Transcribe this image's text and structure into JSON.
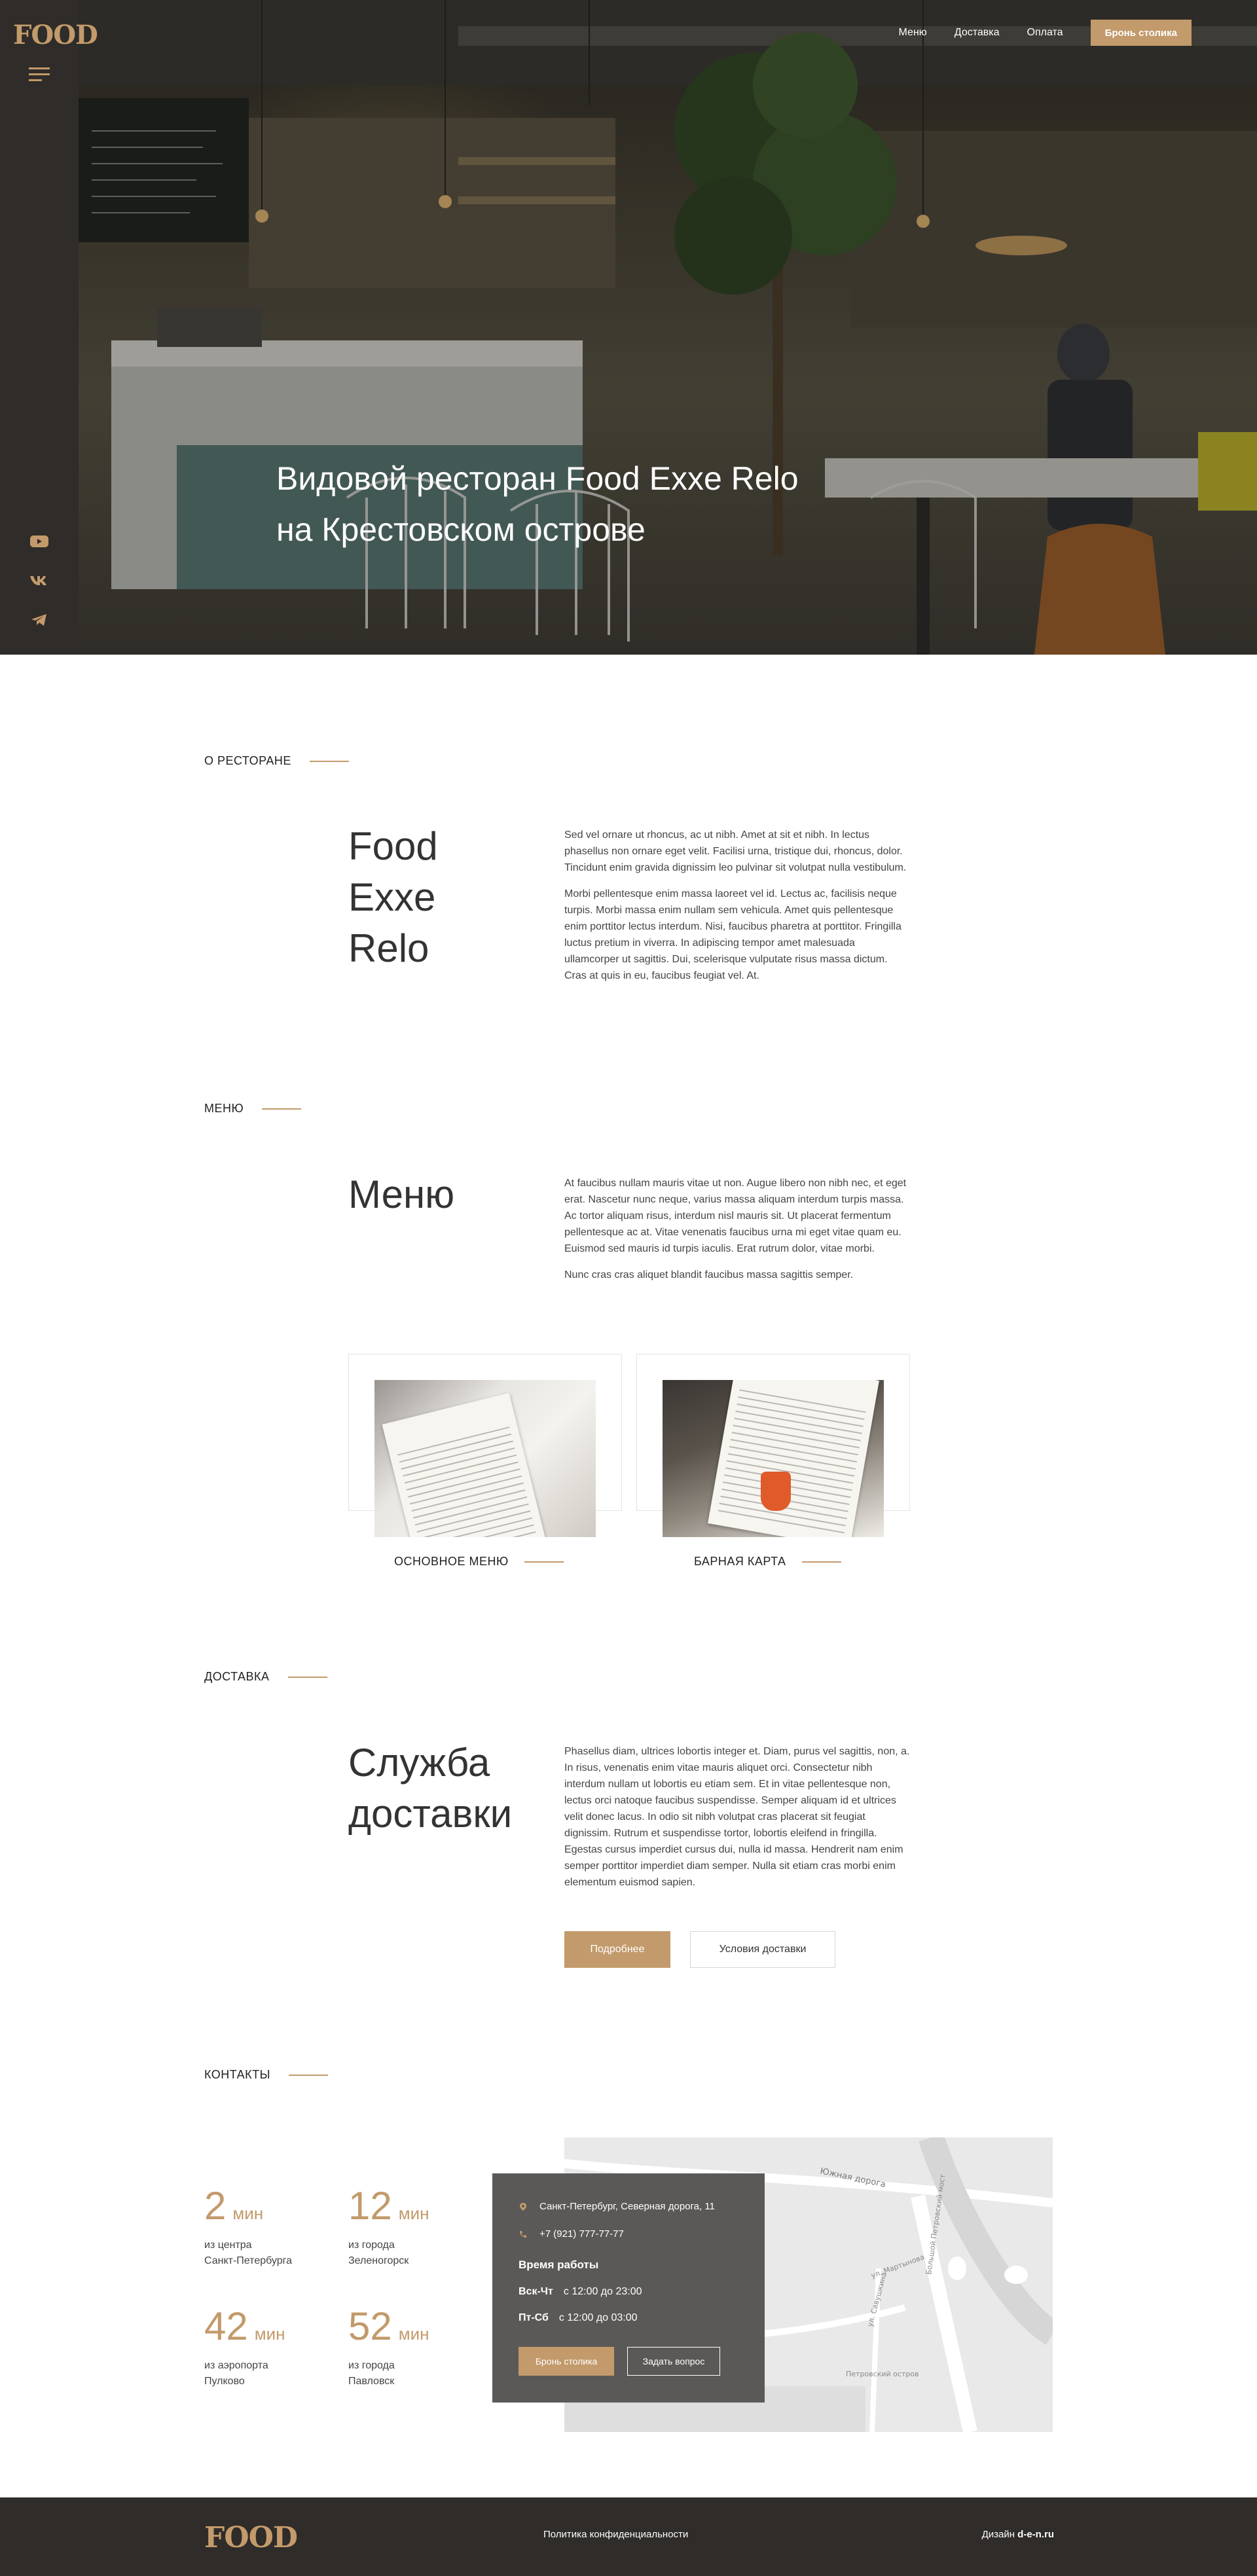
{
  "brand": {
    "logo": "FOOD",
    "accent": "#c29a6b",
    "dark": "#2f2c29"
  },
  "nav": {
    "menu": "Меню",
    "delivery": "Доставка",
    "payment": "Оплата",
    "book": "Бронь столика"
  },
  "sidebar": {
    "burger": "burger-menu-icon",
    "social": [
      "youtube-icon",
      "vk-icon",
      "telegram-icon"
    ]
  },
  "hero": {
    "title_line1": "Видовой ресторан Food Exxe Relo",
    "title_line2": "на Крестовском острове"
  },
  "about": {
    "label": "О РЕСТОРАНЕ",
    "title_line1": "Food",
    "title_line2": "Exxe",
    "title_line3": "Relo",
    "p1": "Sed vel ornare ut rhoncus, ac ut nibh. Amet at sit et nibh. In lectus phasellus non ornare eget velit. Facilisi urna, tristique dui, rhoncus, dolor. Tincidunt enim gravida dignissim leo pulvinar sit volutpat nulla vestibulum.",
    "p2": "Morbi pellentesque enim massa laoreet vel id. Lectus ac, facilisis neque turpis. Morbi massa enim nullam sem vehicula. Amet quis pellentesque enim porttitor lectus interdum. Nisi, faucibus pharetra at porttitor. Fringilla luctus pretium in viverra. In adipiscing tempor amet malesuada ullamcorper ut sagittis. Dui, scelerisque vulputate risus massa dictum. Cras at quis in eu, faucibus feugiat vel. At."
  },
  "menu": {
    "label": "МЕНЮ",
    "title": "Меню",
    "p1": "At faucibus nullam mauris vitae ut non. Augue libero non nibh nec, et eget erat. Nascetur nunc neque, varius massa aliquam interdum turpis massa. Ac tortor aliquam risus, interdum nisl mauris sit. Ut placerat fermentum pellentesque ac at. Vitae venenatis faucibus urna mi eget vitae quam eu. Euismod sed mauris id turpis iaculis. Erat rutrum dolor, vitae morbi.",
    "p2": "Nunc cras cras aliquet blandit faucibus massa sagittis semper.",
    "card1": "ОСНОВНОЕ МЕНЮ",
    "card2": "БАРНАЯ КАРТА"
  },
  "delivery": {
    "label": "ДОСТАВКА",
    "title_line1": "Служба",
    "title_line2": "доставки",
    "p1": "Phasellus diam, ultrices lobortis integer et. Diam, purus vel sagittis, non, a. In risus, venenatis enim vitae mauris aliquet orci. Consectetur nibh interdum nullam ut lobortis eu etiam sem. Et in vitae pellentesque non, lectus orci natoque faucibus suspendisse. Semper aliquam id et ultrices velit donec lacus. In odio sit nibh volutpat cras placerat sit feugiat dignissim. Rutrum et suspendisse tortor, lobortis eleifend in fringilla. Egestas cursus imperdiet cursus dui, nulla id massa. Hendrerit nam enim semper porttitor imperdiet diam semper. Nulla sit etiam cras morbi enim elementum euismod sapien.",
    "btn_more": "Подробнее",
    "btn_terms": "Условия доставки"
  },
  "contacts": {
    "label": "КОНТАКТЫ",
    "stats": [
      {
        "num": "2",
        "unit": "мин",
        "desc1": "из центра",
        "desc2": "Санкт-Петербурга"
      },
      {
        "num": "12",
        "unit": "мин",
        "desc1": "из города",
        "desc2": "Зеленогорск"
      },
      {
        "num": "42",
        "unit": "мин",
        "desc1": "из аэропорта",
        "desc2": "Пулково"
      },
      {
        "num": "52",
        "unit": "мин",
        "desc1": "из города",
        "desc2": "Павловск"
      }
    ],
    "address": "Санкт-Петербург, Северная дорога, 11",
    "phone": "+7 (921) 777-77-77",
    "hours_title": "Время работы",
    "hours": [
      {
        "days": "Вск-Чт",
        "time": "с 12:00 до 23:00"
      },
      {
        "days": "Пт-Сб",
        "time": "с 12:00 до 03:00"
      }
    ],
    "btn_book": "Бронь столика",
    "btn_ask": "Задать вопрос",
    "map_labels": {
      "road": "Южная дорога",
      "street1": "ул. Мартынова",
      "street2": "Большой Петровский мост",
      "street3": "ул. Савушкина",
      "park": "Петровский остров"
    }
  },
  "footer": {
    "logo": "FOOD",
    "privacy": "Политика конфиденциальности",
    "design_prefix": "Дизайн ",
    "design_brand": "d-e-n.ru"
  }
}
